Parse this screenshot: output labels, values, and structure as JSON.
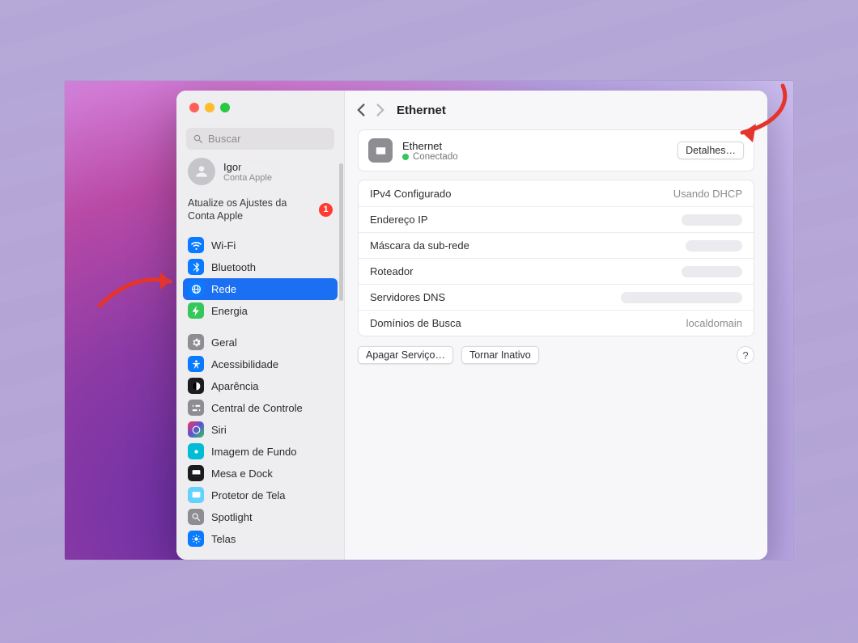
{
  "search": {
    "placeholder": "Buscar"
  },
  "account": {
    "name": "Igor",
    "subtitle": "Conta Apple"
  },
  "alert": {
    "message": "Atualize os Ajustes da Conta Apple",
    "badge": "1"
  },
  "sidebar": {
    "items": [
      {
        "label": "Wi-Fi",
        "icon": "wifi-icon",
        "color": "blue"
      },
      {
        "label": "Bluetooth",
        "icon": "bluetooth-icon",
        "color": "blue"
      },
      {
        "label": "Rede",
        "icon": "globe-icon",
        "color": "blue",
        "selected": true
      },
      {
        "label": "Energia",
        "icon": "bolt-icon",
        "color": "green"
      },
      {
        "gap": true
      },
      {
        "label": "Geral",
        "icon": "gear-icon",
        "color": "gray"
      },
      {
        "label": "Acessibilidade",
        "icon": "accessibility-icon",
        "color": "blue"
      },
      {
        "label": "Aparência",
        "icon": "appearance-icon",
        "color": "black"
      },
      {
        "label": "Central de Controle",
        "icon": "controlcenter-icon",
        "color": "gray"
      },
      {
        "label": "Siri",
        "icon": "siri-icon",
        "color": "multicol"
      },
      {
        "label": "Imagem de Fundo",
        "icon": "wallpaper-icon",
        "color": "teal"
      },
      {
        "label": "Mesa e Dock",
        "icon": "dock-icon",
        "color": "black"
      },
      {
        "label": "Protetor de Tela",
        "icon": "screensaver-icon",
        "color": "aqua"
      },
      {
        "label": "Spotlight",
        "icon": "search-icon",
        "color": "gray"
      },
      {
        "label": "Telas",
        "icon": "displays-icon",
        "color": "blue"
      }
    ]
  },
  "header": {
    "title": "Ethernet"
  },
  "connection": {
    "title": "Ethernet",
    "status": "Conectado",
    "details_button": "Detalhes…"
  },
  "info": [
    {
      "label": "IPv4 Configurado",
      "value": "Usando DHCP"
    },
    {
      "label": "Endereço IP",
      "redact": "r-90"
    },
    {
      "label": "Máscara da sub-rede",
      "redact": "r-80"
    },
    {
      "label": "Roteador",
      "redact": "r-90"
    },
    {
      "label": "Servidores DNS",
      "redact": "r-200"
    },
    {
      "label": "Domínios de Busca",
      "value": "localdomain"
    }
  ],
  "actions": {
    "delete": "Apagar Serviço…",
    "deactivate": "Tornar Inativo",
    "help": "?"
  }
}
